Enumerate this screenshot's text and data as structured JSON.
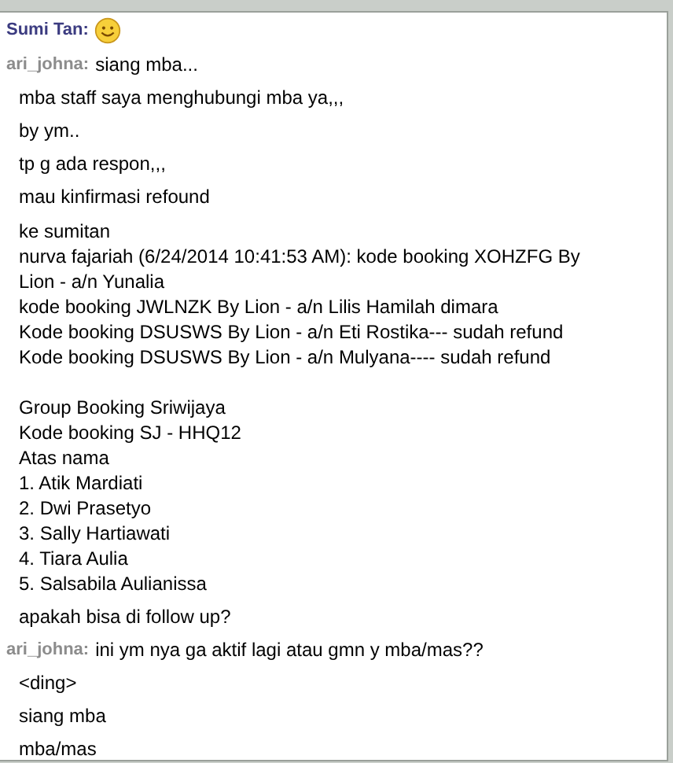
{
  "messages": [
    {
      "kind": "sender",
      "sender": "Sumi Tan:",
      "color": "#3b3b80",
      "emoticon": true
    },
    {
      "kind": "sender",
      "sender": "ari_johna:",
      "color": "#8c8c8c",
      "text": "siang mba..."
    },
    {
      "kind": "line",
      "text": "mba staff saya menghubungi mba ya,,,"
    },
    {
      "kind": "line",
      "text": "by ym.."
    },
    {
      "kind": "line",
      "text": "tp g ada respon,,,"
    },
    {
      "kind": "line",
      "text": "mau kinfirmasi refound"
    },
    {
      "kind": "block",
      "paragraphs": [
        [
          "ke sumitan",
          "nurva fajariah (6/24/2014 10:41:53 AM): kode booking XOHZFG By Lion - a/n Yunalia",
          "kode booking JWLNZK By Lion - a/n Lilis Hamilah dimara",
          "Kode booking DSUSWS By Lion - a/n Eti Rostika--- sudah refund",
          "Kode booking DSUSWS By Lion - a/n Mulyana---- sudah refund"
        ],
        [
          "Group Booking Sriwijaya",
          "Kode booking SJ - HHQ12",
          "Atas nama",
          "1. Atik Mardiati",
          "2. Dwi Prasetyo",
          "3. Sally Hartiawati",
          "4. Tiara Aulia",
          "5. Salsabila Aulianissa"
        ]
      ]
    },
    {
      "kind": "line",
      "text": "apakah bisa di follow up?"
    },
    {
      "kind": "sender",
      "sender": "ari_johna:",
      "color": "#8c8c8c",
      "text": "ini ym nya ga aktif lagi atau gmn y mba/mas??"
    },
    {
      "kind": "line",
      "text": "<ding>"
    },
    {
      "kind": "line",
      "text": "siang mba"
    },
    {
      "kind": "line",
      "text": "mba/mas"
    }
  ]
}
